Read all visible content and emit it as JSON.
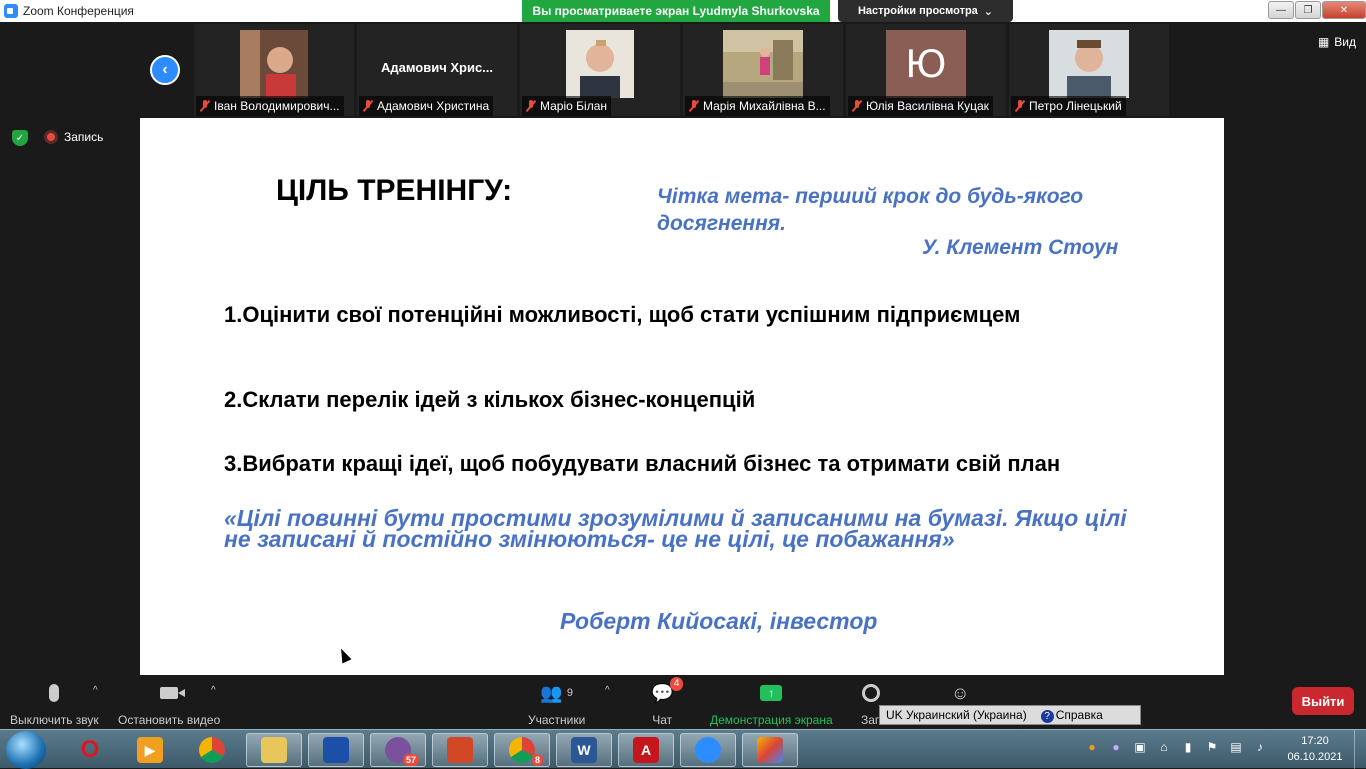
{
  "window": {
    "title": "Zoom Конференция",
    "share_banner": "Вы просматриваете экран Lyudmyla Shurkovska",
    "view_options": "Настройки просмотра",
    "view_options_caret": "⌄",
    "minimize": "—",
    "maximize": "❐",
    "close": "✕"
  },
  "gallery": {
    "nav_prev": "‹",
    "view_label": "Вид",
    "participants": [
      {
        "label": "Іван Володимирович..."
      },
      {
        "label": "Адамович Христина",
        "display_name": "Адамович  Хрис..."
      },
      {
        "label": "Маріо Білан"
      },
      {
        "label": "Марія Михайлівна В..."
      },
      {
        "label": "Юлія Василівна Куцак",
        "initial": "Ю"
      },
      {
        "label": "Петро Лінецький"
      }
    ]
  },
  "status": {
    "recording": "Запись",
    "shield": "✓"
  },
  "slide": {
    "title": "ЦІЛЬ ТРЕНІНГУ:",
    "quote1": "Чітка мета- перший крок до будь-якого досягнення.",
    "quote1_author": "У. Клемент Стоун",
    "goal1": "1.Оцінити свої потенційні можливості, щоб стати успішним підприємцем",
    "goal2": "2.Склати перелік ідей з кількох бізнес-концепцій",
    "goal3": "3.Вибрати кращі ідеї, щоб побудувати власний бізнес та отримати свій план",
    "quote2": "«Цілі повинні бути простими зрозумілими й записаними на бумазі. Якщо цілі не записані й постійно змінюються- це не цілі, це побажання»",
    "quote2_author": "Роберт Кийосакі, інвестор"
  },
  "controls": {
    "mute": "Выключить звук",
    "stop_video": "Остановить видео",
    "participants": "Участники",
    "participants_count": "9",
    "chat": "Чат",
    "chat_badge": "4",
    "share_screen": "Демонстрация экрана",
    "record_partial": "Зап",
    "leave": "Выйти",
    "caret": "^",
    "share_arrow": "↑"
  },
  "language_bar": {
    "language": "UK Украинский (Украина)",
    "help_icon": "?",
    "help": "Справка"
  },
  "taskbar": {
    "opera_glyph": "O",
    "word_glyph": "W",
    "pdf_glyph": "A",
    "viber_badge": "57",
    "chrome2_badge": "8",
    "time": "17:20",
    "date": "06.10.2021"
  },
  "colors": {
    "slide_accent": "#4a72c4",
    "share_green": "#22a640",
    "zoom_blue": "#2d8cff",
    "leave_red": "#c8282e"
  }
}
